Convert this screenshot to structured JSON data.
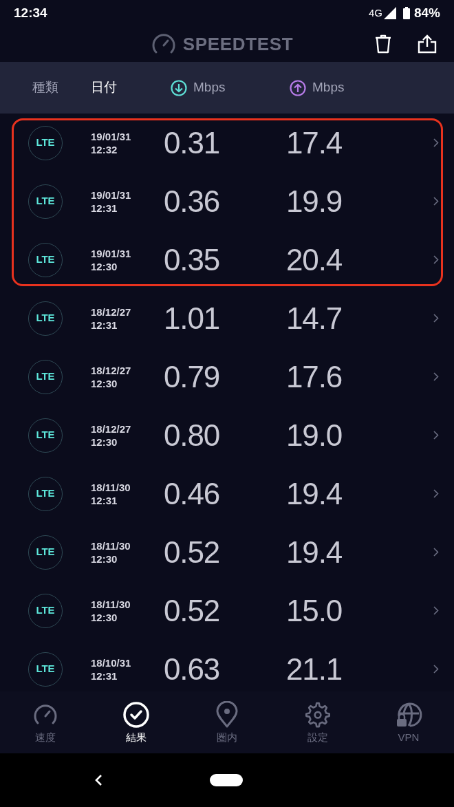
{
  "status_bar": {
    "time": "12:34",
    "network": "4G",
    "battery": "84%"
  },
  "app_bar": {
    "title": "SPEEDTEST"
  },
  "columns": [
    {
      "kind": "text",
      "label": "種類",
      "selected": false
    },
    {
      "kind": "text",
      "label": "日付",
      "selected": true
    },
    {
      "kind": "download",
      "label": "Mbps",
      "selected": false
    },
    {
      "kind": "upload",
      "label": "Mbps",
      "selected": false
    }
  ],
  "rows": [
    {
      "type": "LTE",
      "date": "19/01/31",
      "time": "12:32",
      "download": "0.31",
      "upload": "17.4",
      "highlighted": true
    },
    {
      "type": "LTE",
      "date": "19/01/31",
      "time": "12:31",
      "download": "0.36",
      "upload": "19.9",
      "highlighted": true
    },
    {
      "type": "LTE",
      "date": "19/01/31",
      "time": "12:30",
      "download": "0.35",
      "upload": "20.4",
      "highlighted": true
    },
    {
      "type": "LTE",
      "date": "18/12/27",
      "time": "12:31",
      "download": "1.01",
      "upload": "14.7",
      "highlighted": false
    },
    {
      "type": "LTE",
      "date": "18/12/27",
      "time": "12:30",
      "download": "0.79",
      "upload": "17.6",
      "highlighted": false
    },
    {
      "type": "LTE",
      "date": "18/12/27",
      "time": "12:30",
      "download": "0.80",
      "upload": "19.0",
      "highlighted": false
    },
    {
      "type": "LTE",
      "date": "18/11/30",
      "time": "12:31",
      "download": "0.46",
      "upload": "19.4",
      "highlighted": false
    },
    {
      "type": "LTE",
      "date": "18/11/30",
      "time": "12:30",
      "download": "0.52",
      "upload": "19.4",
      "highlighted": false
    },
    {
      "type": "LTE",
      "date": "18/11/30",
      "time": "12:30",
      "download": "0.52",
      "upload": "15.0",
      "highlighted": false
    },
    {
      "type": "LTE",
      "date": "18/10/31",
      "time": "12:31",
      "download": "0.63",
      "upload": "21.1",
      "highlighted": false
    }
  ],
  "tabs": [
    {
      "kind": "speed",
      "label": "速度",
      "selected": false
    },
    {
      "kind": "results",
      "label": "結果",
      "selected": true
    },
    {
      "kind": "coverage",
      "label": "圏内",
      "selected": false
    },
    {
      "kind": "settings",
      "label": "設定",
      "selected": false
    },
    {
      "kind": "vpn",
      "label": "VPN",
      "selected": false
    }
  ]
}
